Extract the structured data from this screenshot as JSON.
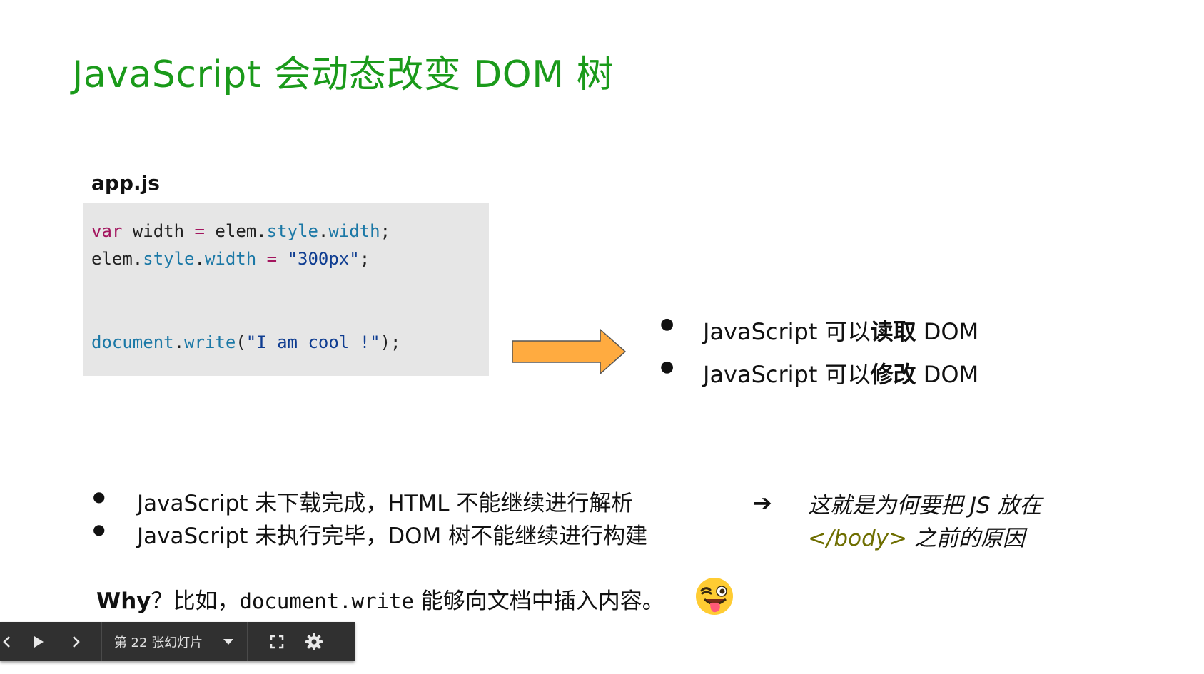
{
  "slide": {
    "title": "JavaScript 会动态改变 DOM 树",
    "code_file": "app.js",
    "code": {
      "line1": {
        "kw": "var",
        "a": " width ",
        "op": "=",
        "b": " elem.",
        "p1": "style",
        "dot": ".",
        "p2": "width",
        "end": ";"
      },
      "line2": {
        "a": "elem.",
        "p1": "style",
        "dot": ".",
        "p2": "width",
        "b": " ",
        "op": "=",
        "c": " ",
        "str": "\"300px\"",
        "end": ";"
      },
      "line3": {
        "obj": "document",
        "dot": ".",
        "fn": "write",
        "open": "(",
        "str": "\"I am cool !\"",
        "close": ");"
      }
    },
    "right_bullets": [
      {
        "bullet": "●",
        "prefix": "JavaScript 可以",
        "bold": "读取",
        "suffix": " DOM"
      },
      {
        "bullet": "●",
        "prefix": "JavaScript 可以",
        "bold": "修改",
        "suffix": " DOM"
      }
    ],
    "bottom_bullets": [
      {
        "bullet": "●",
        "text": "JavaScript 未下载完成，HTML 不能继续进行解析"
      },
      {
        "bullet": "●",
        "text": "JavaScript 未执行完毕，DOM 树不能继续进行构建"
      }
    ],
    "conclusion": {
      "arrow": "➔",
      "line1": "这就是为何要把 JS 放在",
      "tag": "</body>",
      "line2_rest": " 之前的原因"
    },
    "why": {
      "bold": "Why",
      "text1": "？比如，",
      "code": "document.write",
      "text2": " 能够向文档中插入内容。"
    },
    "emoji": "winking-face-with-tongue",
    "colors": {
      "title": "#1a9a1a",
      "arrow_fill": "#ffab40",
      "keyword": "#a3155e",
      "property": "#1b78a6",
      "string": "#0f3d91",
      "tag": "#6e6e00",
      "toolbar_bg": "#303030"
    }
  },
  "toolbar": {
    "prev_icon": "chevron-left-icon",
    "play_icon": "play-icon",
    "next_icon": "chevron-right-icon",
    "slide_label": "第 22 张幻灯片",
    "dropdown_icon": "caret-down-icon",
    "fullscreen_icon": "fullscreen-icon",
    "settings_icon": "gear-icon"
  }
}
